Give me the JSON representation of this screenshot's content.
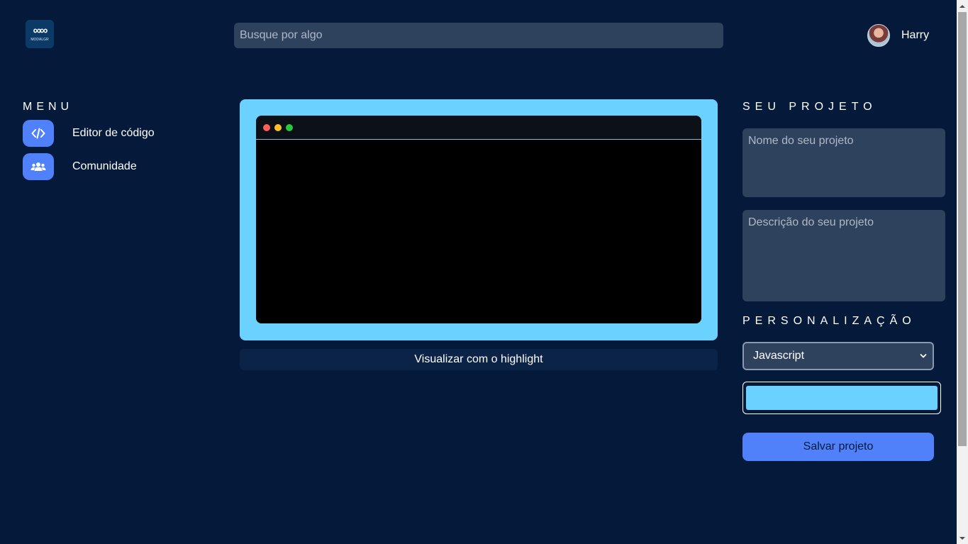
{
  "header": {
    "logo_text": "MODALGR",
    "search_placeholder": "Busque por algo",
    "user_name": "Harry"
  },
  "menu": {
    "title": "MENU",
    "items": [
      {
        "label": "Editor de código",
        "icon": "code-icon"
      },
      {
        "label": "Comunidade",
        "icon": "users-icon"
      }
    ]
  },
  "editor": {
    "code": "",
    "window_dots": [
      "#ff5f56",
      "#ffbd2e",
      "#27c93f"
    ],
    "frame_color": "#6bd1ff",
    "highlight_label": "Visualizar com o highlight"
  },
  "project": {
    "title": "SEU PROJETO",
    "name_placeholder": "Nome do seu projeto",
    "description_placeholder": "Descrição do seu projeto"
  },
  "customization": {
    "title": "PERSONALIZAÇÃO",
    "language_selected": "Javascript",
    "color_value": "#6bd1ff",
    "save_label": "Salvar projeto"
  },
  "colors": {
    "background": "#051a3b",
    "accent": "#5081fb",
    "input_bg": "#2e425e"
  }
}
